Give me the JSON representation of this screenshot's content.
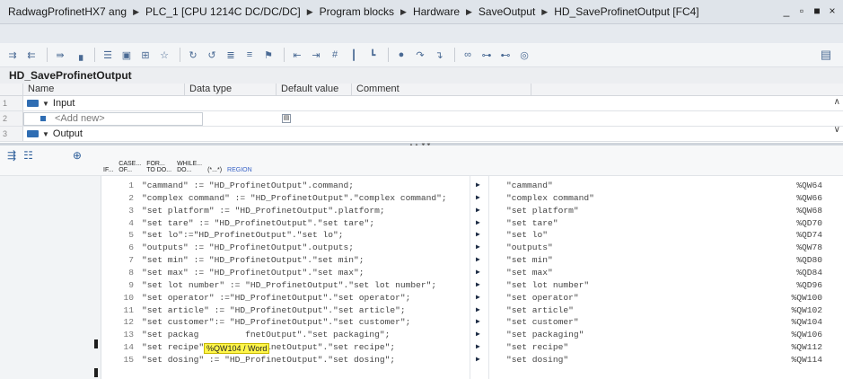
{
  "breadcrumb": [
    "RadwagProfinetHX7 ang",
    "PLC_1 [CPU 1214C DC/DC/DC]",
    "Program blocks",
    "Hardware",
    "SaveOutput",
    "HD_SaveProfinetOutput [FC4]"
  ],
  "window_controls": [
    "_",
    "▫",
    "■",
    "×"
  ],
  "block_name": "HD_SaveProfinetOutput",
  "interface": {
    "columns": [
      "Name",
      "Data type",
      "Default value",
      "Comment"
    ],
    "rows": [
      {
        "num": "1",
        "name": "Input"
      },
      {
        "num": "2",
        "name": "<Add new>"
      },
      {
        "num": "3",
        "name": "Output"
      }
    ]
  },
  "scl_keywords": [
    "IF...",
    "CASE...\nOF...",
    "FOR...\nTO DO...",
    "WHILE...\nDO...",
    "(*...*)",
    "REGION"
  ],
  "code_lines": [
    {
      "ln": "1",
      "code": "\"cammand\" := \"HD_ProfinetOutput\".command;",
      "var": "\"cammand\"",
      "addr": "%QW64"
    },
    {
      "ln": "2",
      "code": "\"complex command\" := \"HD_ProfinetOutput\".\"complex command\";",
      "var": "\"complex command\"",
      "addr": "%QW66"
    },
    {
      "ln": "3",
      "code": "\"set platform\" := \"HD_ProfinetOutput\".platform;",
      "var": "\"set platform\"",
      "addr": "%QW68"
    },
    {
      "ln": "4",
      "code": "\"set tare\" := \"HD_ProfinetOutput\".\"set tare\";",
      "var": "\"set tare\"",
      "addr": "%QD70"
    },
    {
      "ln": "5",
      "code": "\"set lo\":=\"HD_ProfinetOutput\".\"set lo\";",
      "var": "\"set lo\"",
      "addr": "%QD74"
    },
    {
      "ln": "6",
      "code": "\"outputs\" := \"HD_ProfinetOutput\".outputs;",
      "var": "\"outputs\"",
      "addr": "%QW78"
    },
    {
      "ln": "7",
      "code": "\"set min\" := \"HD_ProfinetOutput\".\"set min\";",
      "var": "\"set min\"",
      "addr": "%QD80"
    },
    {
      "ln": "8",
      "code": "\"set max\" := \"HD_ProfinetOutput\".\"set max\";",
      "var": "\"set max\"",
      "addr": "%QD84"
    },
    {
      "ln": "9",
      "code": "\"set lot number\" := \"HD_ProfinetOutput\".\"set lot number\";",
      "var": "\"set lot number\"",
      "addr": "%QD96"
    },
    {
      "ln": "10",
      "code": "\"set operator\" :=\"HD_ProfinetOutput\".\"set operator\";",
      "var": "\"set operator\"",
      "addr": "%QW100"
    },
    {
      "ln": "11",
      "code": "\"set article\" := \"HD_ProfinetOutput\".\"set article\";",
      "var": "\"set article\"",
      "addr": "%QW102"
    },
    {
      "ln": "12",
      "code": "\"set customer\":= \"HD_ProfinetOutput\".\"set customer\";",
      "var": "\"set customer\"",
      "addr": "%QW104"
    },
    {
      "ln": "13",
      "code": "\"set packag         fnetOutput\".\"set packaging\";",
      "var": "\"set packaging\"",
      "addr": "%QW106"
    },
    {
      "ln": "14",
      "code": "\"set recipe\" := \"HD_ProfinetOutput\".\"set recipe\";",
      "var": "\"set recipe\"",
      "addr": "%QW112"
    },
    {
      "ln": "15",
      "code": "\"set dosing\" := \"HD_ProfinetOutput\".\"set dosing\";",
      "var": "\"set dosing\"",
      "addr": "%QW114"
    }
  ],
  "tooltip": "%QW104 / Word"
}
